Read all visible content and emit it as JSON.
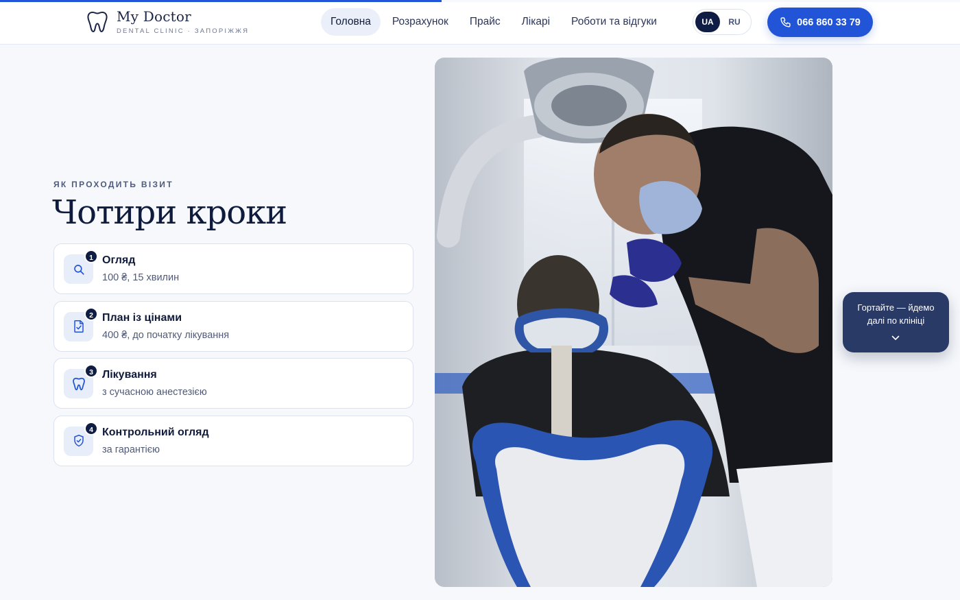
{
  "progress": {
    "value": 0.46
  },
  "header": {
    "brand": "My Doctor",
    "tagline": "DENTAL CLINIC · ЗАПОРІЖЖЯ",
    "nav": [
      {
        "label": "Головна",
        "active": true
      },
      {
        "label": "Розрахунок"
      },
      {
        "label": "Прайс"
      },
      {
        "label": "Лікарі"
      },
      {
        "label": "Роботи та відгуки"
      }
    ],
    "languages": [
      {
        "label": "UA",
        "active": true
      },
      {
        "label": "RU"
      }
    ],
    "phone": "066 860 33 79"
  },
  "section": {
    "eyebrow": "ЯК ПРОХОДИТЬ ВІЗИТ",
    "title": "Чотири кроки",
    "steps": [
      {
        "num": "1",
        "title": "Огляд",
        "subtitle": "100 ₴, 15 хвилин",
        "icon": "search-icon"
      },
      {
        "num": "2",
        "title": "План із цінами",
        "subtitle": "400 ₴, до початку лікування",
        "icon": "document-check-icon"
      },
      {
        "num": "3",
        "title": "Лікування",
        "subtitle": "з сучасною анестезією",
        "icon": "tooth-icon"
      },
      {
        "num": "4",
        "title": "Контрольний огляд",
        "subtitle": "за гарантією",
        "icon": "shield-check-icon"
      }
    ]
  },
  "scroll_hint": {
    "text": "Гортайте — йдемо далі по клініці",
    "icon": "chevron-down-icon"
  },
  "colors": {
    "accent": "#2154d6",
    "navy": "#0f1d44",
    "hint_bg": "#2a3a66"
  }
}
